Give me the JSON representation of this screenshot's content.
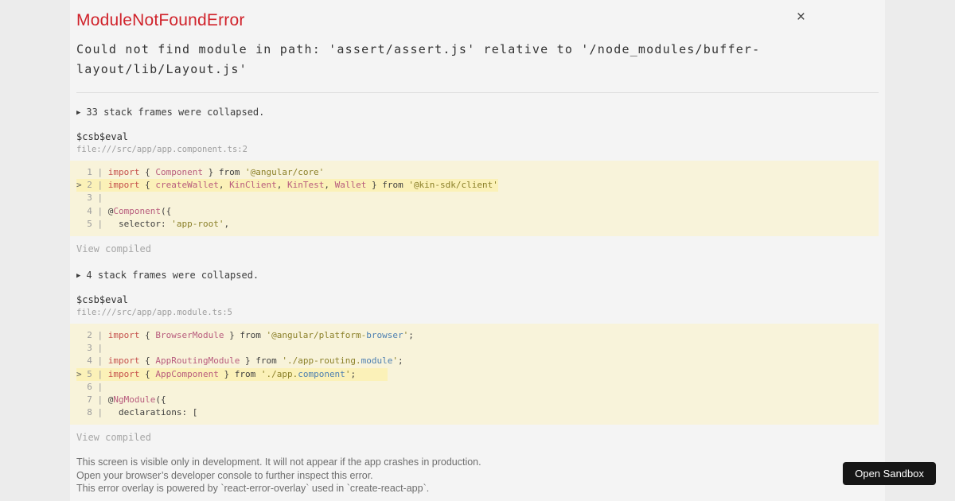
{
  "overlay": {
    "title": "ModuleNotFoundError",
    "message": "Could not find module in path: 'assert/assert.js' relative to '/node_modules/buffer-layout/lib/Layout.js'"
  },
  "icons": {
    "close": "×",
    "collapsed_marker": "▶"
  },
  "sections": [
    {
      "collapsed_label": "33 stack frames were collapsed.",
      "function": "$csb$eval",
      "file": "file:///src/app/app.component.ts:2",
      "view_compiled": "View compiled",
      "code": [
        {
          "n": "1",
          "h": false,
          "t": [
            [
              "k",
              "import"
            ],
            [
              "p",
              " { "
            ],
            [
              "i",
              "Component"
            ],
            [
              "p",
              " } from "
            ],
            [
              "s",
              "'@angular/core'"
            ]
          ]
        },
        {
          "n": "2",
          "h": true,
          "t": [
            [
              "k",
              "import"
            ],
            [
              "p",
              " { "
            ],
            [
              "i",
              "createWallet"
            ],
            [
              "p",
              ", "
            ],
            [
              "i",
              "KinClient"
            ],
            [
              "p",
              ", "
            ],
            [
              "i",
              "KinTest"
            ],
            [
              "p",
              ", "
            ],
            [
              "i",
              "Wallet"
            ],
            [
              "p",
              " } from "
            ],
            [
              "s",
              "'@kin-sdk/client'"
            ]
          ]
        },
        {
          "n": "3",
          "h": false,
          "t": []
        },
        {
          "n": "4",
          "h": false,
          "t": [
            [
              "p",
              "@"
            ],
            [
              "i",
              "Component"
            ],
            [
              "p",
              "({"
            ]
          ]
        },
        {
          "n": "5",
          "h": false,
          "t": [
            [
              "p",
              "  selector: "
            ],
            [
              "s",
              "'app-root'"
            ],
            [
              "p",
              ","
            ]
          ]
        }
      ]
    },
    {
      "collapsed_label": "4 stack frames were collapsed.",
      "function": "$csb$eval",
      "file": "file:///src/app/app.module.ts:5",
      "view_compiled": "View compiled",
      "code": [
        {
          "n": "2",
          "h": false,
          "t": [
            [
              "k",
              "import"
            ],
            [
              "p",
              " { "
            ],
            [
              "i",
              "BrowserModule"
            ],
            [
              "p",
              " } from "
            ],
            [
              "s",
              "'@angular/platform-"
            ],
            [
              "b",
              "browser"
            ],
            [
              "s",
              "'"
            ],
            [
              "p",
              ";"
            ]
          ]
        },
        {
          "n": "3",
          "h": false,
          "t": []
        },
        {
          "n": "4",
          "h": false,
          "t": [
            [
              "k",
              "import"
            ],
            [
              "p",
              " { "
            ],
            [
              "i",
              "AppRoutingModule"
            ],
            [
              "p",
              " } from "
            ],
            [
              "s",
              "'./app-routing."
            ],
            [
              "b",
              "module"
            ],
            [
              "s",
              "'"
            ],
            [
              "p",
              ";"
            ]
          ]
        },
        {
          "n": "5",
          "h": true,
          "t": [
            [
              "k",
              "import"
            ],
            [
              "p",
              " { "
            ],
            [
              "i",
              "AppComponent"
            ],
            [
              "p",
              " } from "
            ],
            [
              "s",
              "'./app."
            ],
            [
              "b",
              "component"
            ],
            [
              "s",
              "'"
            ],
            [
              "p",
              ";      "
            ]
          ]
        },
        {
          "n": "6",
          "h": false,
          "t": []
        },
        {
          "n": "7",
          "h": false,
          "t": [
            [
              "p",
              "@"
            ],
            [
              "i",
              "NgModule"
            ],
            [
              "p",
              "({"
            ]
          ]
        },
        {
          "n": "8",
          "h": false,
          "t": [
            [
              "p",
              "  declarations: ["
            ]
          ]
        }
      ]
    }
  ],
  "footer": {
    "lines": [
      "This screen is visible only in development. It will not appear if the app crashes in production.",
      "Open your browser’s developer console to further inspect this error.",
      "This error overlay is powered by `react-error-overlay` used in `create-react-app`."
    ]
  },
  "open_sandbox": {
    "label": "Open Sandbox"
  },
  "colors": {
    "page_bg": "#ececec",
    "overlay_bg": "#f4f4f4",
    "title_red": "#d0232b",
    "keyword_red": "#c5504c",
    "ident_pink": "#b85c7d",
    "string_olive": "#8b8029",
    "blue_token": "#4c7fb1",
    "plain": "#3f3f3f",
    "lineno_gray": "#9c9c9c",
    "code_bg": "#f8f3da",
    "highlight_bg": "#fbf1b8",
    "divider": "#dedede",
    "file_gray": "#9e9e9e",
    "muted_gray": "#a6a6a6",
    "footer_gray": "#6e6e6e",
    "button_bg": "#161616"
  }
}
